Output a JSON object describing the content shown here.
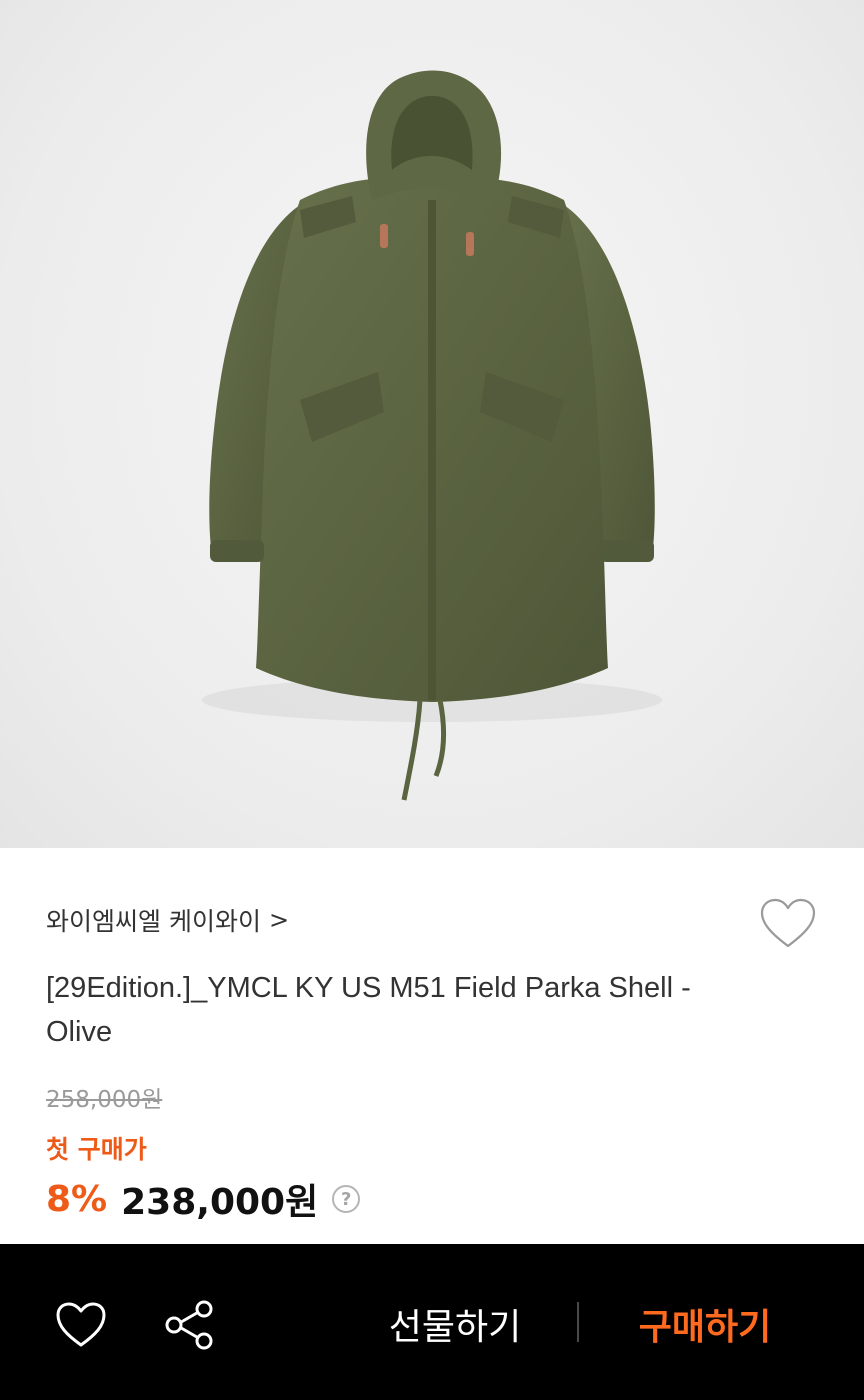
{
  "product_image": {
    "alt": "olive field parka",
    "icon": "product-photo"
  },
  "brand": {
    "name": "와이엠씨엘 케이와이",
    "chevron": ">"
  },
  "product": {
    "title": "[29Edition.]_YMCL KY US M51 Field Parka Shell - Olive"
  },
  "pricing": {
    "original_price": "258,000원",
    "first_purchase_label": "첫 구매가",
    "discount": "8%",
    "price": "238,000원",
    "help": "?"
  },
  "action_bar": {
    "gift_label": "선물하기",
    "buy_label": "구매하기"
  },
  "colors": {
    "accent": "#ee5a17",
    "buy_accent": "#ff6a1f",
    "bar_background": "#000000",
    "parka_olive": "#5c6542"
  }
}
